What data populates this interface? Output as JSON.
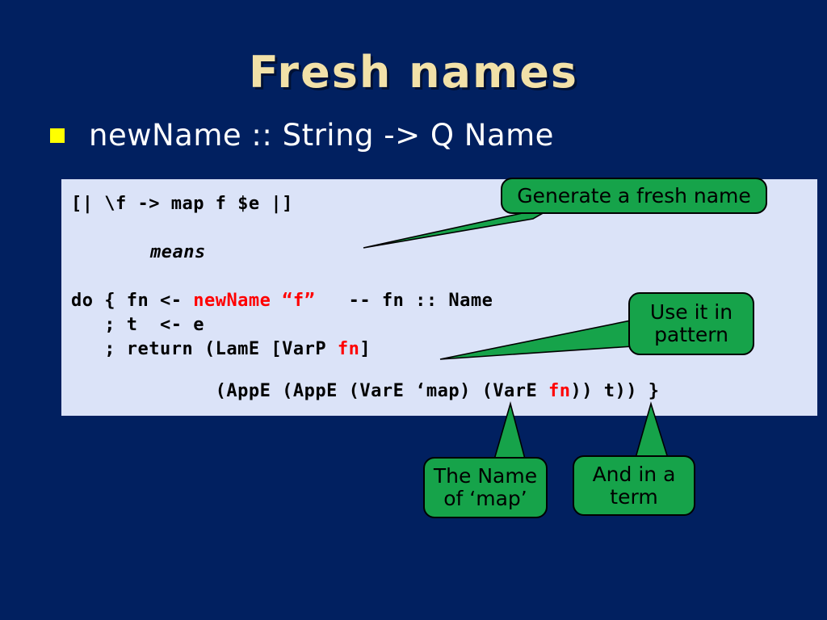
{
  "slide": {
    "title": "Fresh names",
    "background_color": "#012060",
    "accent_green": "#16a34a",
    "title_color": "#f2e1a8",
    "code_panel_color": "#dbe3f8",
    "bullet_color": "#ffff00",
    "highlight_color": "#ff0000"
  },
  "bullet": {
    "text": "newName :: String -> Q Name"
  },
  "code": {
    "line_quote": "[| \\f -> map f $e |]",
    "line_means": "means",
    "line_do_prefix": "do { fn <- ",
    "line_do_red": "newName “f”",
    "line_do_suffix": "   -- fn :: Name",
    "line_t": "   ; t  <- e",
    "line_return_prefix": "   ; return (LamE [VarP ",
    "line_return_red": "fn",
    "line_return_suffix": "]",
    "line_appe_prefix": "             (AppE (AppE (VarE ‘map) (VarE ",
    "line_appe_red": "fn",
    "line_appe_suffix": ")) t)) }"
  },
  "callouts": [
    {
      "id": "generate",
      "text": "Generate a fresh name"
    },
    {
      "id": "pattern",
      "text": "Use it in\npattern"
    },
    {
      "id": "mapname",
      "text": "The Name\nof ‘map’"
    },
    {
      "id": "term",
      "text": "And in a\nterm"
    }
  ]
}
